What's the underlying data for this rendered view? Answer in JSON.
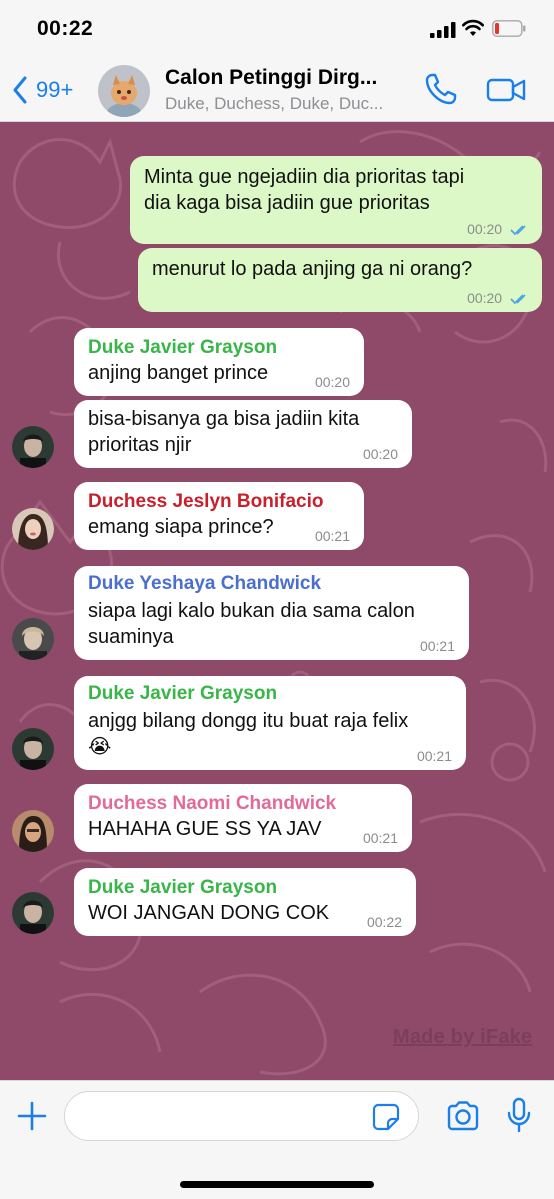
{
  "status_bar": {
    "time": "00:22"
  },
  "header": {
    "unread_count": "99+",
    "title": "Calon Petinggi Dirg...",
    "members": "Duke, Duchess, Duke, Duc..."
  },
  "colors": {
    "accent": "#1a7fe8",
    "chat_background": "#8e4a68",
    "outgoing_bubble": "#dcf8c6",
    "incoming_bubble": "#ffffff",
    "sender_green": "#3ab54a",
    "sender_red": "#c8202d",
    "sender_blue": "#4a6fd0",
    "sender_pink": "#e26a9a"
  },
  "messages": [
    {
      "direction": "out",
      "lines": [
        "Minta gue ngejadiin dia prioritas tapi",
        "dia kaga bisa jadiin gue prioritas"
      ],
      "time": "00:20",
      "status": "read"
    },
    {
      "direction": "out",
      "lines": [
        "menurut lo pada anjing ga ni orang?"
      ],
      "time": "00:20",
      "status": "read"
    },
    {
      "direction": "in",
      "sender": "Duke Javier Grayson",
      "lines": [
        "anjing banget prince"
      ],
      "time": "00:20"
    },
    {
      "direction": "in",
      "lines": [
        "bisa-bisanya ga bisa jadiin kita",
        "prioritas njir"
      ],
      "time": "00:20"
    },
    {
      "direction": "in",
      "sender": "Duchess Jeslyn Bonifacio",
      "lines": [
        "emang siapa prince?"
      ],
      "time": "00:21"
    },
    {
      "direction": "in",
      "sender": "Duke Yeshaya Chandwick",
      "lines": [
        "siapa lagi kalo bukan dia sama calon",
        "suaminya"
      ],
      "time": "00:21"
    },
    {
      "direction": "in",
      "sender": "Duke Javier Grayson",
      "lines": [
        "anjgg bilang dongg itu buat raja felix",
        "😭"
      ],
      "time": "00:21"
    },
    {
      "direction": "in",
      "sender": "Duchess Naomi Chandwick",
      "lines": [
        "HAHAHA GUE SS YA JAV"
      ],
      "time": "00:21"
    },
    {
      "direction": "in",
      "sender": "Duke Javier Grayson",
      "lines": [
        "WOI JANGAN DONG COK"
      ],
      "time": "00:22"
    }
  ],
  "watermark": "Made by iFake",
  "input": {
    "value": "",
    "placeholder": ""
  },
  "icons": [
    "back-chevron-icon",
    "phone-icon",
    "video-camera-icon",
    "plus-icon",
    "sticker-icon",
    "camera-icon",
    "microphone-icon",
    "double-check-icon"
  ]
}
